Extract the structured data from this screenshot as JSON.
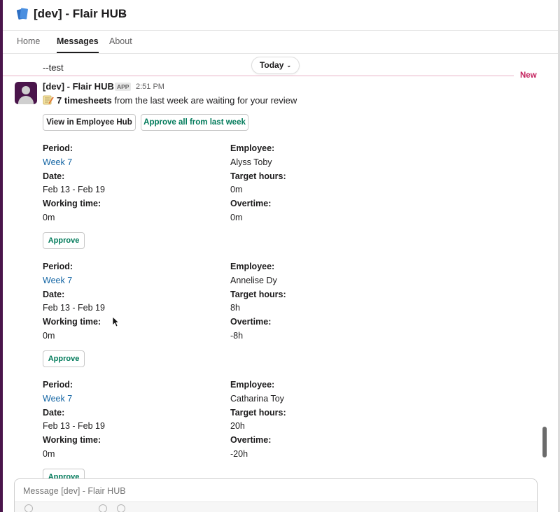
{
  "header": {
    "title": "[dev] - Flair HUB",
    "chevron": "⌄",
    "logo_icon": "app-logo-icon"
  },
  "tabs": [
    {
      "label": "Home",
      "active": false
    },
    {
      "label": "Messages",
      "active": true
    },
    {
      "label": "About",
      "active": false
    }
  ],
  "previous_message": "--test",
  "date_divider": {
    "label": "Today",
    "chevron": "⌄"
  },
  "new_divider": {
    "label": "New",
    "color": "#c4225e"
  },
  "message": {
    "sender": "[dev] - Flair HUB",
    "badge": "APP",
    "time": "2:51 PM",
    "emoji_icon": "memo-icon",
    "text_bold": "7 timesheets",
    "text_rest": " from the last week are waiting for your review",
    "buttons": {
      "view_hub": "View in Employee Hub",
      "approve_all": "Approve all from last week"
    },
    "timesheets": [
      {
        "period_label": "Period:",
        "period": "Week 7",
        "date_label": "Date:",
        "date": "Feb 13 - Feb 19",
        "working_label": "Working time:",
        "working": "0m",
        "employee_label": "Employee:",
        "employee": "Alyss Toby",
        "target_label": "Target hours:",
        "target": "0m",
        "overtime_label": "Overtime:",
        "overtime": "0m",
        "approve": "Approve"
      },
      {
        "period_label": "Period:",
        "period": "Week 7",
        "date_label": "Date:",
        "date": "Feb 13 - Feb 19",
        "working_label": "Working time:",
        "working": "0m",
        "employee_label": "Employee:",
        "employee": "Annelise Dy",
        "target_label": "Target hours:",
        "target": "8h",
        "overtime_label": "Overtime:",
        "overtime": "-8h",
        "approve": "Approve"
      },
      {
        "period_label": "Period:",
        "period": "Week 7",
        "date_label": "Date:",
        "date": "Feb 13 - Feb 19",
        "working_label": "Working time:",
        "working": "0m",
        "employee_label": "Employee:",
        "employee": "Catharina Toy",
        "target_label": "Target hours:",
        "target": "20h",
        "overtime_label": "Overtime:",
        "overtime": "-20h",
        "approve": "Approve"
      }
    ]
  },
  "composer": {
    "placeholder": "Message [dev] - Flair HUB"
  },
  "colors": {
    "brand": "#4a154b",
    "link": "#1264a3",
    "approve": "#007a5a"
  }
}
